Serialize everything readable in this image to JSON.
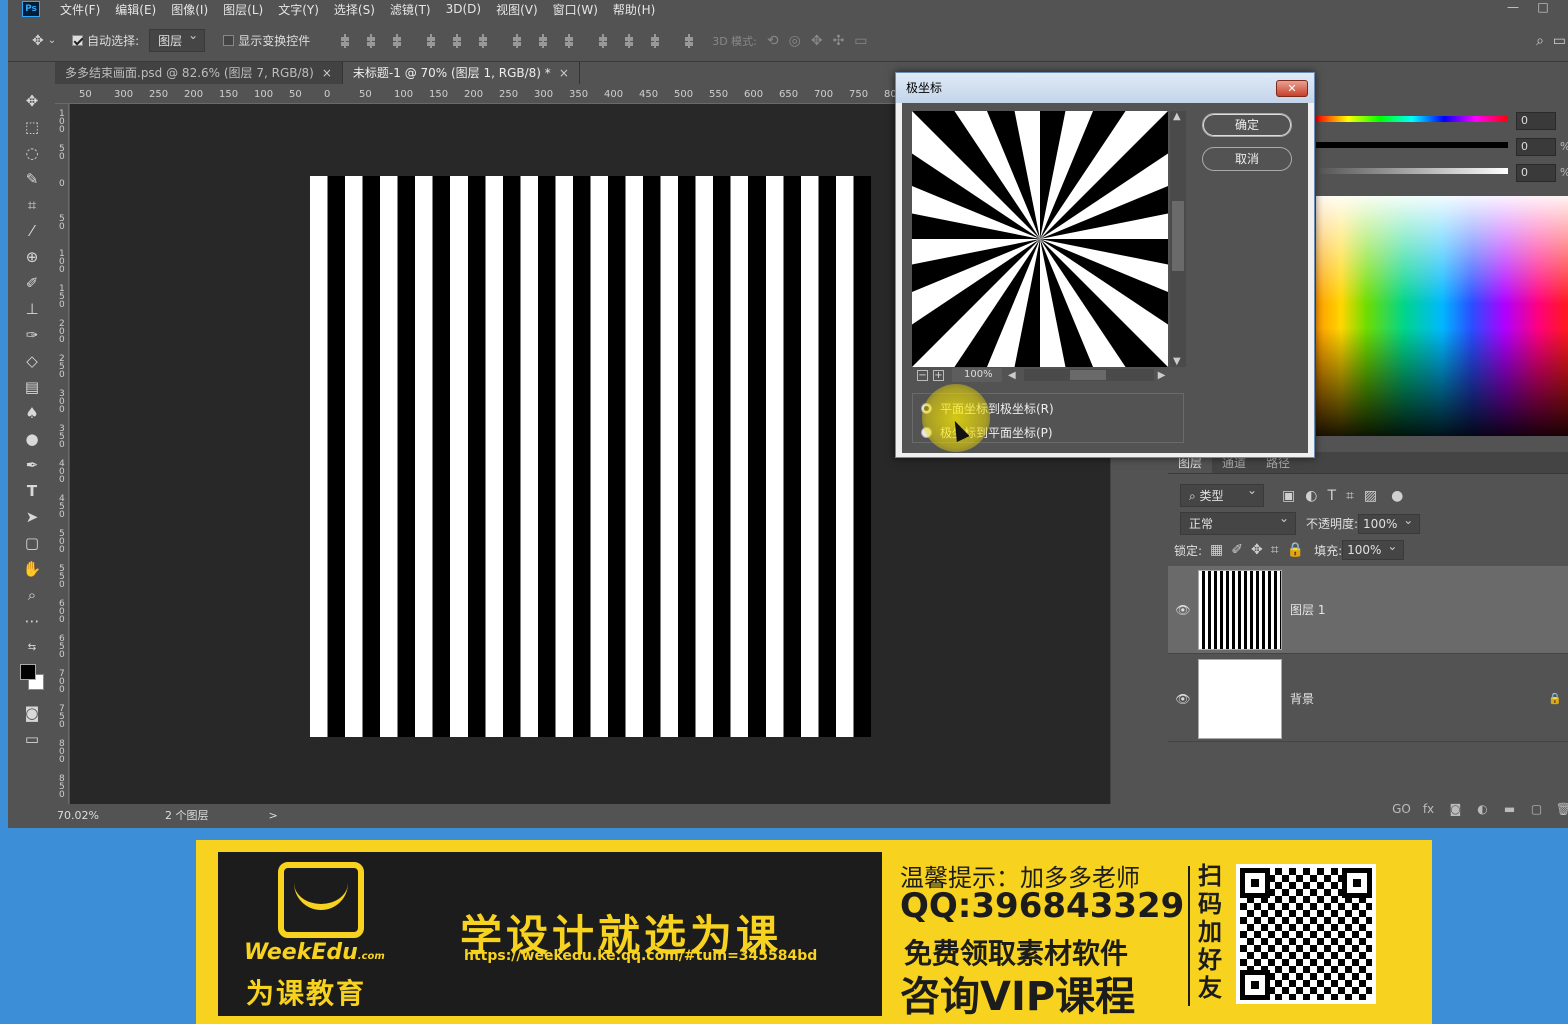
{
  "app": {
    "logo": "Ps",
    "window_controls": [
      "—",
      "□"
    ]
  },
  "menu": [
    "文件(F)",
    "编辑(E)",
    "图像(I)",
    "图层(L)",
    "文字(Y)",
    "选择(S)",
    "滤镜(T)",
    "3D(D)",
    "视图(V)",
    "窗口(W)",
    "帮助(H)"
  ],
  "options": {
    "auto_select_label": "自动选择:",
    "auto_select_value": "图层",
    "show_transform_label": "显示变换控件",
    "mode3d_label": "3D 模式:"
  },
  "tabs": [
    {
      "label": "多多结束画面.psd @ 82.6% (图层 7, RGB/8)",
      "close": "×"
    },
    {
      "label": "未标题-1 @ 70% (图层 1, RGB/8) *",
      "close": "×"
    }
  ],
  "ruler_h": [
    "50",
    "300",
    "250",
    "200",
    "150",
    "100",
    "50",
    "0",
    "50",
    "100",
    "150",
    "200",
    "250",
    "300",
    "350",
    "400",
    "450",
    "500",
    "550",
    "600",
    "650",
    "700",
    "750",
    "800"
  ],
  "ruler_v": [
    "1 0 0",
    "5 0",
    "0",
    "5 0",
    "1 0 0",
    "1 5 0",
    "2 0 0",
    "2 5 0",
    "3 0 0",
    "3 5 0",
    "4 0 0",
    "4 5 0",
    "5 0 0",
    "5 5 0",
    "6 0 0",
    "6 5 0",
    "7 0 0",
    "7 5 0",
    "8 0 0",
    "8 5 0"
  ],
  "status": {
    "zoom": "70.02%",
    "layers_count": "2 个图层",
    "arrow": ">"
  },
  "color_panel": {
    "values": [
      "0",
      "0",
      "0"
    ],
    "unit": "%"
  },
  "layers": {
    "tabs": [
      "图层",
      "通道",
      "路径"
    ],
    "filter_label": "类型",
    "blend_mode": "正常",
    "opacity_label": "不透明度:",
    "opacity_value": "100%",
    "lock_label": "锁定:",
    "fill_label": "填充:",
    "fill_value": "100%",
    "items": [
      {
        "name": "图层 1",
        "visible": "👁"
      },
      {
        "name": "背景",
        "visible": "👁",
        "lock": "🔒"
      }
    ],
    "bottom_icons": [
      "GO",
      "fx",
      "◙",
      "◐",
      "▬",
      "▢",
      "🗑"
    ]
  },
  "dialog": {
    "title": "极坐标",
    "close": "✕",
    "ok": "确定",
    "cancel": "取消",
    "zoom": "100%",
    "zoom_minus": "−",
    "zoom_plus": "+",
    "options": [
      {
        "label": "平面坐标到极坐标(R)",
        "selected": true
      },
      {
        "label": "极坐标到平面坐标(P)",
        "selected": false
      }
    ]
  },
  "banner": {
    "logo_text": "WeekEdu",
    "logo_com": ".com",
    "logo_cn": "为课教育",
    "slogan": "学设计就选为课",
    "url": "https://weekedu.ke.qq.com/#tuin=345584bd",
    "tip": "温馨提示：加多多老师",
    "qq": "QQ:396843329",
    "free": "免费领取素材软件",
    "vip": "咨询VIP课程",
    "scan": [
      "扫",
      "码",
      "加",
      "好",
      "友"
    ]
  }
}
